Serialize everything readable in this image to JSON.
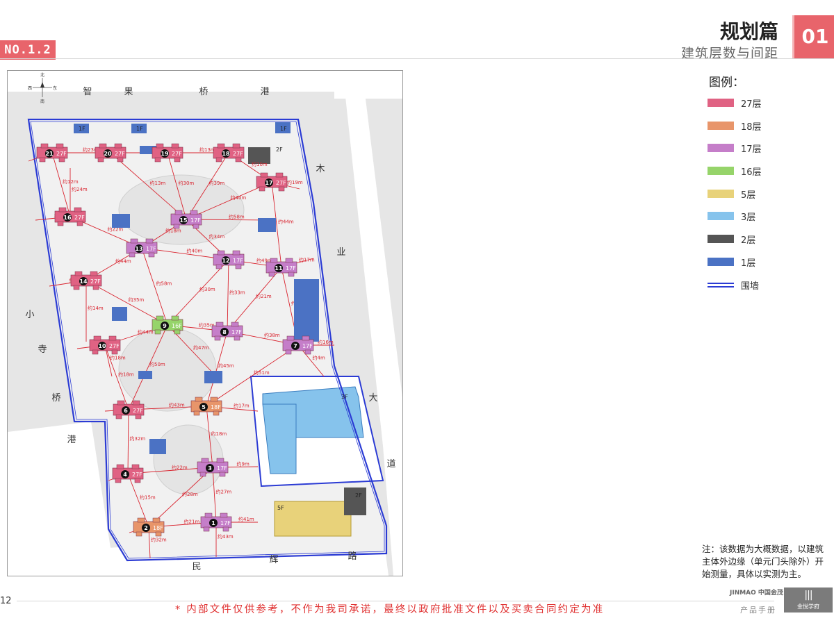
{
  "header": {
    "badge": "NO.1.2",
    "section_title": "规划篇",
    "section_subtitle": "建筑层数与间距",
    "section_number": "01"
  },
  "legend": {
    "title": "图例：",
    "items": [
      {
        "label": "27层",
        "color": "#e06283"
      },
      {
        "label": "18层",
        "color": "#e8956a"
      },
      {
        "label": "17层",
        "color": "#c57ec9"
      },
      {
        "label": "16层",
        "color": "#96d46a"
      },
      {
        "label": "5层",
        "color": "#e8d27a"
      },
      {
        "label": "3层",
        "color": "#86c3ec"
      },
      {
        "label": "2层",
        "color": "#555555"
      },
      {
        "label": "1层",
        "color": "#4b72c4"
      }
    ],
    "wall_label": "围墙",
    "wall_color": "#2b3bd4"
  },
  "map": {
    "roads": {
      "north": [
        "智",
        "果",
        "桥",
        "港"
      ],
      "east_upper": [
        "木",
        "业"
      ],
      "east_lower": [
        "大",
        "道"
      ],
      "west": [
        "小",
        "寺",
        "桥",
        "港"
      ],
      "south": [
        "民",
        "辉",
        "路"
      ]
    },
    "compass": [
      "北",
      "东",
      "西",
      "南"
    ],
    "floor_tags": [
      "27F",
      "18F",
      "17F",
      "16F",
      "5F",
      "3F",
      "2F",
      "1F"
    ],
    "buildings": [
      {
        "no": "1",
        "floors": "17F",
        "color": "#c57ec9"
      },
      {
        "no": "2",
        "floors": "18F",
        "color": "#e8956a"
      },
      {
        "no": "3",
        "floors": "17F",
        "color": "#c57ec9"
      },
      {
        "no": "4",
        "floors": "27F",
        "color": "#e06283"
      },
      {
        "no": "5",
        "floors": "18F",
        "color": "#e8956a"
      },
      {
        "no": "6",
        "floors": "27F",
        "color": "#e06283"
      },
      {
        "no": "7",
        "floors": "17F",
        "color": "#c57ec9"
      },
      {
        "no": "8",
        "floors": "17F",
        "color": "#c57ec9"
      },
      {
        "no": "9",
        "floors": "16F",
        "color": "#96d46a"
      },
      {
        "no": "10",
        "floors": "27F",
        "color": "#e06283"
      },
      {
        "no": "11",
        "floors": "17F",
        "color": "#c57ec9"
      },
      {
        "no": "12",
        "floors": "17F",
        "color": "#c57ec9"
      },
      {
        "no": "13",
        "floors": "17F",
        "color": "#c57ec9"
      },
      {
        "no": "14",
        "floors": "27F",
        "color": "#e06283"
      },
      {
        "no": "15",
        "floors": "17F",
        "color": "#c57ec9"
      },
      {
        "no": "16",
        "floors": "27F",
        "color": "#e06283"
      },
      {
        "no": "17",
        "floors": "27F",
        "color": "#e06283"
      },
      {
        "no": "18",
        "floors": "27F",
        "color": "#e06283"
      },
      {
        "no": "19",
        "floors": "27F",
        "color": "#e06283"
      },
      {
        "no": "20",
        "floors": "27F",
        "color": "#e06283"
      },
      {
        "no": "21",
        "floors": "27F",
        "color": "#e06283"
      }
    ],
    "distances": [
      "约23m",
      "约18m",
      "约13m",
      "约10m",
      "约12m",
      "约22m",
      "约18m",
      "约13m",
      "约30m",
      "约39m",
      "约40m",
      "约58m",
      "约44m",
      "约40m",
      "约34m",
      "约49m",
      "约44m",
      "约35m",
      "约58m",
      "约30m",
      "约35m",
      "约33m",
      "约21m",
      "约38m",
      "约10m",
      "约44m",
      "约18m",
      "约50m",
      "约47m",
      "约43m",
      "约45m",
      "约51m",
      "约32m",
      "约22m",
      "约18m",
      "约15m",
      "约28m",
      "约27m",
      "约21m",
      "约41m",
      "约9m",
      "约17m",
      "约16m",
      "约36m",
      "约48m",
      "约31m",
      "约26m",
      "约12m",
      "约20m",
      "约27m",
      "约32m",
      "约43m",
      "约14m",
      "约24m",
      "约18m",
      "约17m",
      "约4m",
      "约19m"
    ]
  },
  "note": "注：该数据为大概数据，以建筑主体外边缘（单元门头除外）开始测量，具体以实测为主。",
  "footer": {
    "page_number": "12",
    "disclaimer": "* 内部文件仅供参考，不作为我司承诺，最终以政府批准文件以及买卖合同约定为准",
    "brand": "JINMAO 中国金茂",
    "manual_label": "产品手册",
    "logo_text": "金悦学府"
  }
}
